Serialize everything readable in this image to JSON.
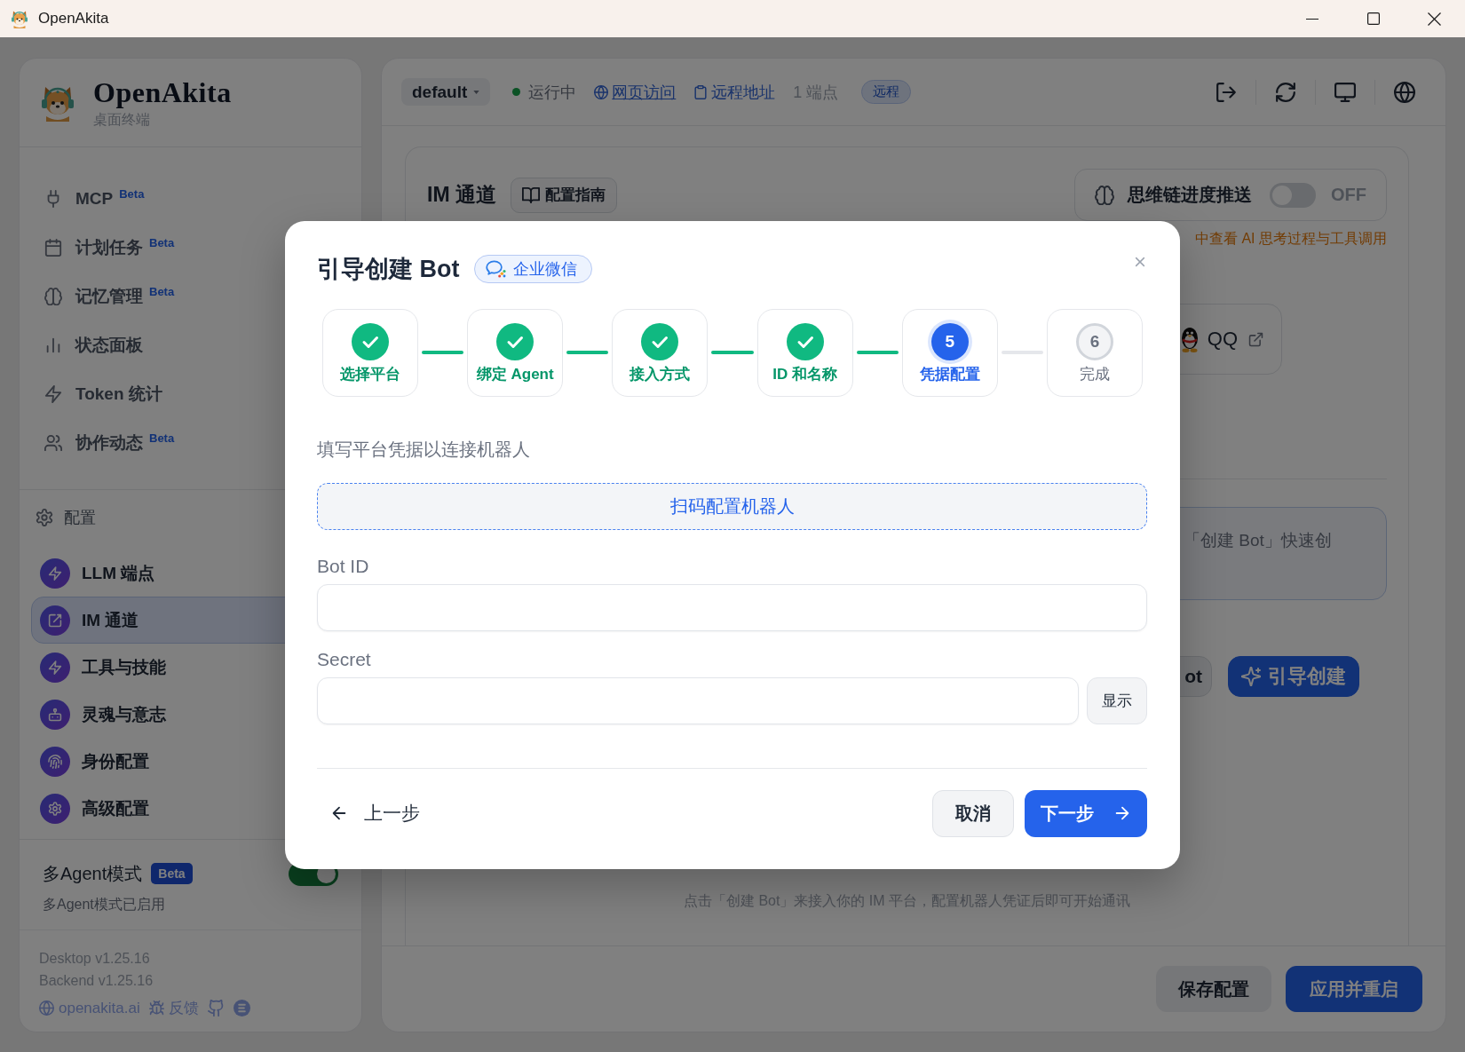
{
  "window": {
    "title": "OpenAkita"
  },
  "sidebar": {
    "brand": {
      "name": "OpenAkita",
      "subtitle": "桌面终端"
    },
    "nav_items": [
      {
        "label": "MCP",
        "badge": "Beta"
      },
      {
        "label": "计划任务",
        "badge": "Beta"
      },
      {
        "label": "记忆管理",
        "badge": "Beta"
      },
      {
        "label": "状态面板"
      },
      {
        "label": "Token 统计"
      },
      {
        "label": "协作动态",
        "badge": "Beta"
      }
    ],
    "config_section": {
      "title": "配置",
      "items": [
        {
          "label": "LLM 端点",
          "selected": false
        },
        {
          "label": "IM 通道",
          "selected": true
        },
        {
          "label": "工具与技能",
          "selected": false
        },
        {
          "label": "灵魂与意志",
          "selected": false
        },
        {
          "label": "身份配置",
          "selected": false
        },
        {
          "label": "高级配置",
          "selected": false
        }
      ]
    },
    "multi_agent": {
      "label": "多Agent模式",
      "badge": "Beta",
      "on": true,
      "description": "多Agent模式已启用"
    },
    "versions": [
      "Desktop v1.25.16",
      "Backend v1.25.16"
    ],
    "links": [
      {
        "label": "openakita.ai"
      },
      {
        "label": "反馈"
      }
    ]
  },
  "top_bar": {
    "profile": "default",
    "status": {
      "label": "运行中",
      "running": true
    },
    "links": [
      {
        "label": "网页访问",
        "underlined": true
      },
      {
        "label": "远程地址",
        "underlined": false
      }
    ],
    "endpoints": "1 端点",
    "mode_badge": "远程"
  },
  "im_page": {
    "title": "IM 通道",
    "guide_button": "配置指南",
    "thinking_push": {
      "label": "思维链进度推送",
      "on": false,
      "state_label": "OFF"
    },
    "thinking_hint": "中查看 AI 思考过程与工具调用",
    "platforms": [
      {
        "name": "QQ"
      }
    ],
    "info_text": "「创建 Bot」快速创",
    "actions": [
      {
        "label": "ot",
        "kind": "secondary"
      },
      {
        "label": "引导创建",
        "kind": "primary"
      }
    ],
    "empty_description": "点击「创建 Bot」来接入你的 IM 平台，配置机器人凭证后即可开始通讯"
  },
  "footer": {
    "buttons": [
      {
        "label": "保存配置",
        "kind": "secondary"
      },
      {
        "label": "应用并重启",
        "kind": "primary"
      }
    ]
  },
  "wizard": {
    "title": "引导创建 Bot",
    "platform": "企业微信",
    "steps": [
      {
        "label": "选择平台",
        "completed": true,
        "selected": false
      },
      {
        "label": "绑定 Agent",
        "completed": true,
        "selected": false
      },
      {
        "label": "接入方式",
        "completed": true,
        "selected": false
      },
      {
        "label": "ID 和名称",
        "completed": true,
        "selected": false
      },
      {
        "label": "凭据配置",
        "completed": false,
        "selected": true,
        "number": "5"
      },
      {
        "label": "完成",
        "completed": false,
        "selected": false,
        "number": "6"
      }
    ],
    "description": "填写平台凭据以连接机器人",
    "scan_button": "扫码配置机器人",
    "fields": [
      {
        "label": "Bot ID"
      },
      {
        "label": "Secret",
        "reveal_button": "显示"
      }
    ],
    "back_button": "上一步",
    "cancel_button": "取消",
    "next_button": "下一步"
  }
}
